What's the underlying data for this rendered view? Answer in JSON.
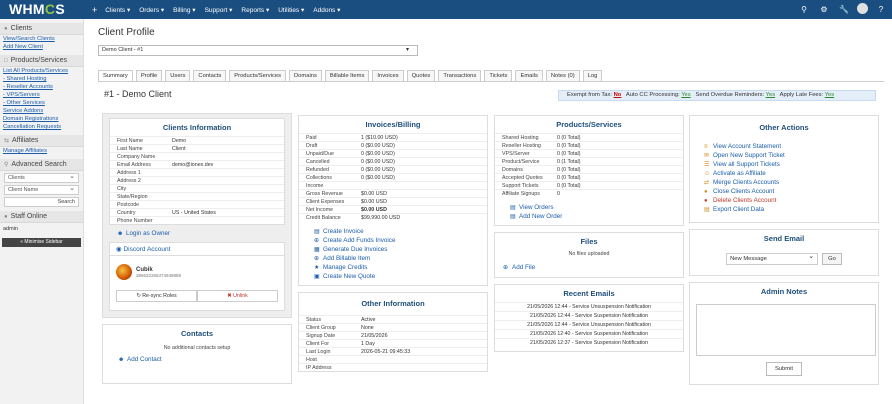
{
  "nav": {
    "logo": "WHMCS",
    "plus": "+",
    "menu": [
      "Clients ▾",
      "Orders ▾",
      "Billing ▾",
      "Support ▾",
      "Reports ▾",
      "Utilities ▾",
      "Addons ▾"
    ],
    "icons": [
      "search-icon",
      "settings-icon",
      "wrench-icon",
      "avatar-icon",
      "help-icon"
    ]
  },
  "sidebar": {
    "clients_head": "Clients",
    "clients_links": [
      "View/Search Clients",
      "Add New Client"
    ],
    "products_head": "Products/Services",
    "products_links": [
      "List All Products/Services",
      "- Shared Hosting",
      "- Reseller Accounts",
      "- VPS/Servers",
      "- Other Services",
      "Service Addons",
      "Domain Registrations",
      "Cancellation Requests"
    ],
    "affiliates_head": "Affiliates",
    "affiliates_link": "Manage Affiliates",
    "search_head": "Advanced Search",
    "search_type": "Clients",
    "search_field": "Client Name",
    "search_button": "Search",
    "staff_head": "Staff Online",
    "staff_name": "admin",
    "minimise": "« Minimise Sidebar"
  },
  "page": {
    "title": "Client Profile",
    "client_select": "Demo Client - #1",
    "tabs": [
      "Summary",
      "Profile",
      "Users",
      "Contacts",
      "Products/Services",
      "Domains",
      "Billable Items",
      "Invoices",
      "Quotes",
      "Transactions",
      "Tickets",
      "Emails",
      "Notes (0)",
      "Log"
    ],
    "summary_title": "#1 - Demo Client",
    "tax_bar": {
      "exempt_label": "Exempt from Tax:",
      "exempt_value": "No",
      "autocc_label": "Auto CC Processing:",
      "autocc_value": "Yes",
      "overdue_label": "Send Overdue Reminders:",
      "overdue_value": "Yes",
      "latefee_label": "Apply Late Fees:",
      "latefee_value": "Yes"
    }
  },
  "client_info": {
    "title": "Clients Information",
    "rows": [
      [
        "First Name",
        "Demo"
      ],
      [
        "Last Name",
        "Client"
      ],
      [
        "Company Name",
        ""
      ],
      [
        "Email Address",
        "demo@ionex.dev"
      ],
      [
        "Address 1",
        ""
      ],
      [
        "Address 2",
        ""
      ],
      [
        "City",
        ""
      ],
      [
        "State/Region",
        ""
      ],
      [
        "Postcode",
        ""
      ],
      [
        "Country",
        "US - United States"
      ],
      [
        "Phone Number",
        ""
      ]
    ],
    "login_as_owner": "Login as Owner"
  },
  "discord": {
    "title": "Discord Account",
    "username": "Cubik",
    "user_id": "386632265374949888",
    "resync": "↻ Re-sync Roles",
    "unlink": "✖ Unlink"
  },
  "contacts": {
    "title": "Contacts",
    "empty": "No additional contacts setup",
    "add": "Add Contact"
  },
  "invoices": {
    "title": "Invoices/Billing",
    "rows": [
      [
        "Paid",
        "1 ($10.00 USD)",
        false
      ],
      [
        "Draft",
        "0 ($0.00 USD)",
        false
      ],
      [
        "Unpaid/Due",
        "0 ($0.00 USD)",
        false
      ],
      [
        "Cancelled",
        "0 ($0.00 USD)",
        false
      ],
      [
        "Refunded",
        "0 ($0.00 USD)",
        false
      ],
      [
        "Collections",
        "0 ($0.00 USD)",
        false
      ],
      [
        "Income",
        "",
        false
      ],
      [
        "Gross Revenue",
        "$0.00 USD",
        false
      ],
      [
        "Client Expenses",
        "$0.00 USD",
        false
      ],
      [
        "Net Income",
        "$0.00 USD",
        true
      ],
      [
        "Credit Balance",
        "$99,990.00 USD",
        false
      ]
    ],
    "actions": [
      "Create Invoice",
      "Create Add Funds Invoice",
      "Generate Due Invoices",
      "Add Billable Item",
      "Manage Credits",
      "Create New Quote"
    ]
  },
  "other_info": {
    "title": "Other Information",
    "rows": [
      [
        "Status",
        "Active"
      ],
      [
        "Client Group",
        "None"
      ],
      [
        "Signup Date",
        "21/05/2026"
      ],
      [
        "Client For",
        "1 Day"
      ],
      [
        "Last Login",
        "2026-05-21 09:45:33"
      ],
      [
        "Host",
        ""
      ],
      [
        "IP Address",
        ""
      ]
    ]
  },
  "products": {
    "title": "Products/Services",
    "rows": [
      [
        "Shared Hosting",
        "0 (0 Total)"
      ],
      [
        "Reseller Hosting",
        "0 (0 Total)"
      ],
      [
        "VPS/Server",
        "0 (0 Total)"
      ],
      [
        "Product/Service",
        "0 (1 Total)"
      ],
      [
        "Domains",
        "0 (0 Total)"
      ],
      [
        "Accepted Quotes",
        "0 (0 Total)"
      ],
      [
        "Support Tickets",
        "0 (0 Total)"
      ],
      [
        "Affiliate Signups",
        "0"
      ]
    ],
    "actions": [
      "View Orders",
      "Add New Order"
    ]
  },
  "files": {
    "title": "Files",
    "empty": "No files uploaded",
    "add": "Add File"
  },
  "recent_emails": {
    "title": "Recent Emails",
    "items": [
      "21/05/2026 12:44 - Service Unsuspension Notification",
      "21/05/2026 12:44 - Service Suspension Notification",
      "21/05/2026 12:44 - Service Unsuspension Notification",
      "21/05/2026 12:40 - Service Suspension Notification",
      "21/05/2026 12:37 - Service Suspension Notification"
    ]
  },
  "other_actions": {
    "title": "Other Actions",
    "items": [
      {
        "label": "View Account Statement",
        "icon": "statement-icon",
        "glyph": "≡",
        "red": false
      },
      {
        "label": "Open New Support Ticket",
        "icon": "ticket-icon",
        "glyph": "✉",
        "red": false
      },
      {
        "label": "View all Support Tickets",
        "icon": "tickets-icon",
        "glyph": "☰",
        "red": false
      },
      {
        "label": "Activate as Affiliate",
        "icon": "affiliate-icon",
        "glyph": "☺",
        "red": false
      },
      {
        "label": "Merge Clients Accounts",
        "icon": "merge-icon",
        "glyph": "⇄",
        "red": false
      },
      {
        "label": "Close Clients Account",
        "icon": "close-account-icon",
        "glyph": "●",
        "red": false
      },
      {
        "label": "Delete Clients Account",
        "icon": "delete-icon",
        "glyph": "●",
        "red": true
      },
      {
        "label": "Export Client Data",
        "icon": "export-icon",
        "glyph": "▤",
        "red": false
      }
    ]
  },
  "send_email": {
    "title": "Send Email",
    "select": "New Message",
    "go": "Go"
  },
  "admin_notes": {
    "title": "Admin Notes",
    "submit": "Submit"
  }
}
